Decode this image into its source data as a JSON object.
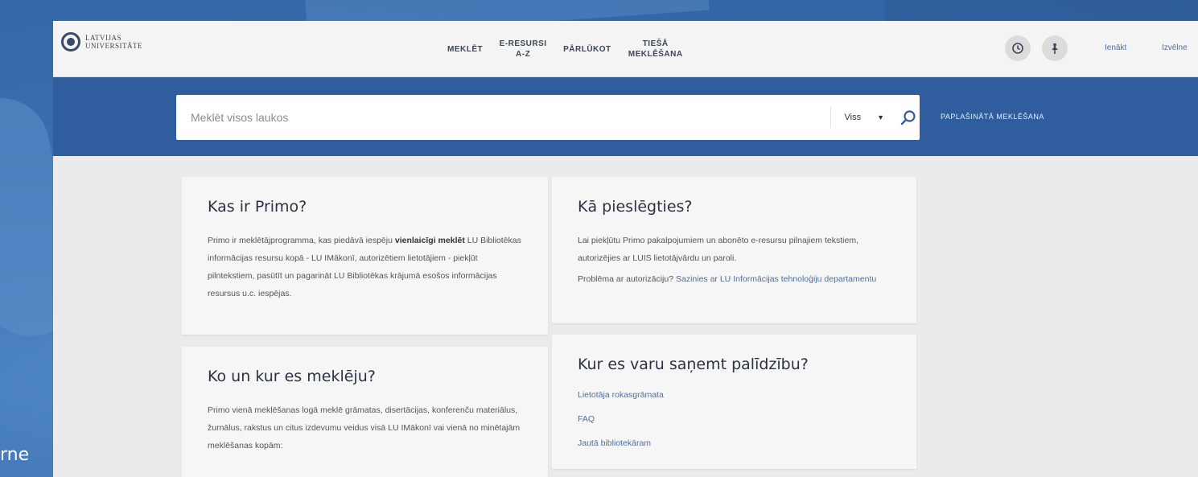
{
  "background_caption": "rne",
  "header": {
    "logo": {
      "line1": "LATVIJAS",
      "line2": "UNIVERSITĀTE"
    },
    "nav": [
      "MEKLĒT",
      "E-RESURSI A-Z",
      "PĀRLŪKOT",
      "TIEŠĀ MEKLĒŠANA"
    ],
    "icons": [
      "history-icon",
      "pin-icon"
    ],
    "signin_label": "Ienākt",
    "menu_label": "Izvēlne"
  },
  "search": {
    "placeholder": "Meklēt visos laukos",
    "scope_value": "Viss",
    "advanced_label": "PAPLAŠINĀTĀ MEKLĒŠANA"
  },
  "cards": {
    "primo": {
      "title": "Kas ir Primo?",
      "text_a": "Primo ir meklētājprogramma, kas piedāvā iespēju ",
      "text_bold_a": "vienlaicīgi meklēt",
      "text_b": " LU Bibliotēkas informācijas resursu kopā - LU IMākonī, autorizētiem lietotājiem - piekļūt pilntekstiem, pasūtīt un pagarināt LU Bibliotēkas krājumā esošos informācijas resursus u.c. iespējas."
    },
    "connect": {
      "title": "Kā pieslēgties?",
      "text": "Lai piekļūtu Primo pakalpojumiem un abonēto e-resursu pilnajiem tekstiem, autorizējies ar LUIS lietotājvārdu un paroli.",
      "problem_text": "Problēma ar autorizāciju? ",
      "problem_link": "Sazinies ar LU Informācijas tehnoloģiju departamentu"
    },
    "where": {
      "title": "Ko un kur es meklēju?",
      "text": "Primo vienā meklēšanas logā meklē grāmatas, disertācijas, konferenču materiālus, žurnālus, rakstus un citus izdevumu veidus visā LU IMākonī vai vienā no minētajām meklēšanas kopām:"
    },
    "help": {
      "title": "Kur es varu saņemt palīdzību?",
      "links": [
        "Lietotāja rokasgrāmata",
        "FAQ",
        "Jautā bibliotekāram"
      ]
    }
  }
}
